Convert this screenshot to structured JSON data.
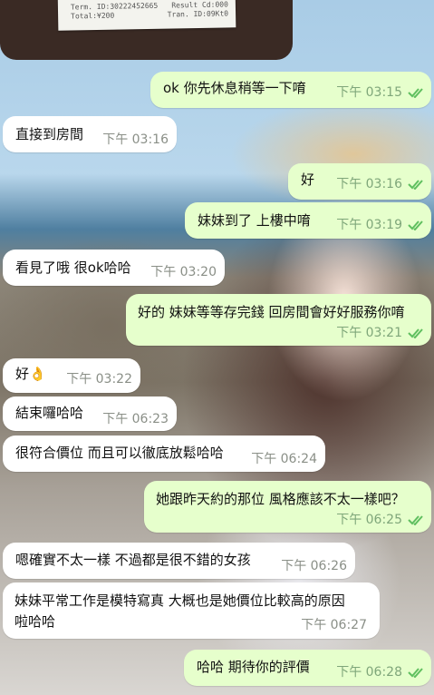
{
  "receipt": {
    "term_label": "Term. ID:30222452665",
    "result_label": "Result Cd:000",
    "total_label": "Total:¥200",
    "tran_label": "Tran. ID:09Kt0"
  },
  "messages": [
    {
      "dir": "out",
      "text": "ok 你先休息稍等一下唷",
      "time": "下午 03:15"
    },
    {
      "dir": "in",
      "text": "直接到房間",
      "time": "下午 03:16"
    },
    {
      "dir": "out",
      "text": "好",
      "time": "下午 03:16"
    },
    {
      "dir": "out",
      "text": "妹妹到了 上樓中唷",
      "time": "下午 03:19"
    },
    {
      "dir": "in",
      "text": "看見了哦 很ok哈哈",
      "time": "下午 03:20"
    },
    {
      "dir": "out",
      "text": "好的 妹妹等等存完錢 回房間會好好服務你唷",
      "time": "下午 03:21"
    },
    {
      "dir": "in",
      "text": "好👌",
      "time": "下午 03:22"
    },
    {
      "dir": "in",
      "text": "結束囉哈哈",
      "time": "下午 06:23"
    },
    {
      "dir": "in",
      "text": "很符合價位 而且可以徹底放鬆哈哈",
      "time": "下午 06:24"
    },
    {
      "dir": "out",
      "text": "她跟昨天約的那位 風格應該不太一樣吧？",
      "time": "下午 06:25"
    },
    {
      "dir": "in",
      "text": "嗯確實不太一樣 不過都是很不錯的女孩",
      "time": "下午 06:26"
    },
    {
      "dir": "in",
      "text_line1": "妹妹平常工作是模特寫真 大概也是她價位比較高的原因",
      "text_line2": "啦哈哈",
      "time": "下午 06:27"
    },
    {
      "dir": "out",
      "text": "哈哈 期待你的評價",
      "time": "下午 06:28"
    }
  ],
  "colors": {
    "outgoing_bubble": "#e6ffcc",
    "incoming_bubble": "#ffffff",
    "read_check": "#5fbf5f"
  },
  "icons": {
    "read_receipt": "double-check-icon"
  }
}
